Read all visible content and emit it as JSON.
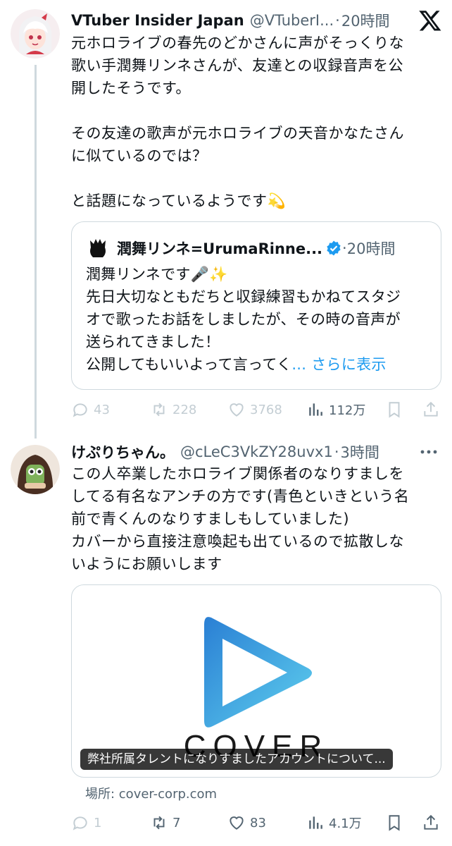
{
  "tweet1": {
    "name": "VTuber Insider Japan",
    "handle": "@VTuberI...",
    "dot": "·",
    "time": "20時間",
    "text": "元ホロライブの春先のどかさんに声がそっくりな\n歌い手潤舞リンネさんが、友達との収録音声を公\n開したそうです。\n\nその友達の歌声が元ホロライブの天音かなたさん\nに似ているのでは？\n\nと話題になっているようです💫",
    "quote": {
      "name": "潤舞リンネ=UrumaRinne...",
      "dot": "·",
      "time": "20時間",
      "text": "潤舞リンネです🎤✨\n先日大切なともだちと収録練習もかねてスタジ\nオで歌ったお話をしましたが、その時の音声が\n送られてきました！\n公開してもいいよって言ってく",
      "more": "... さらに表示"
    },
    "actions": {
      "replies": "43",
      "retweets": "228",
      "likes": "3768",
      "views": "112万"
    }
  },
  "tweet2": {
    "name": "けぷりちゃん。",
    "handle": "@cLeC3VkZY28uvx1",
    "dot": "·",
    "time": "3時間",
    "text": "この人卒業したホロライブ関係者のなりすましを\nしてる有名なアンチの方です(青色といきという名\n前で青くんのなりすましもしていました)\nカバーから直接注意喚起も出ているので拡散しな\nいようにお願いします",
    "card": {
      "logo_text": "COVER",
      "caption": "弊社所属タレントになりすましたアカウントについて...",
      "domain": "場所: cover-corp.com"
    },
    "actions": {
      "replies": "1",
      "retweets": "7",
      "likes": "83",
      "views": "4.1万"
    }
  },
  "icons": {
    "platform_logo": "x-logo-icon",
    "more": "more-icon",
    "reply": "reply-icon",
    "retweet": "retweet-icon",
    "like": "heart-icon",
    "views": "views-icon",
    "bookmark": "bookmark-icon",
    "share": "share-icon",
    "verified": "verified-badge-icon"
  },
  "colors": {
    "text": "#0f1419",
    "secondary": "#536471",
    "link": "#1d9bf0",
    "border": "#cfd9de",
    "faded_actions": "#c3cdd3"
  }
}
